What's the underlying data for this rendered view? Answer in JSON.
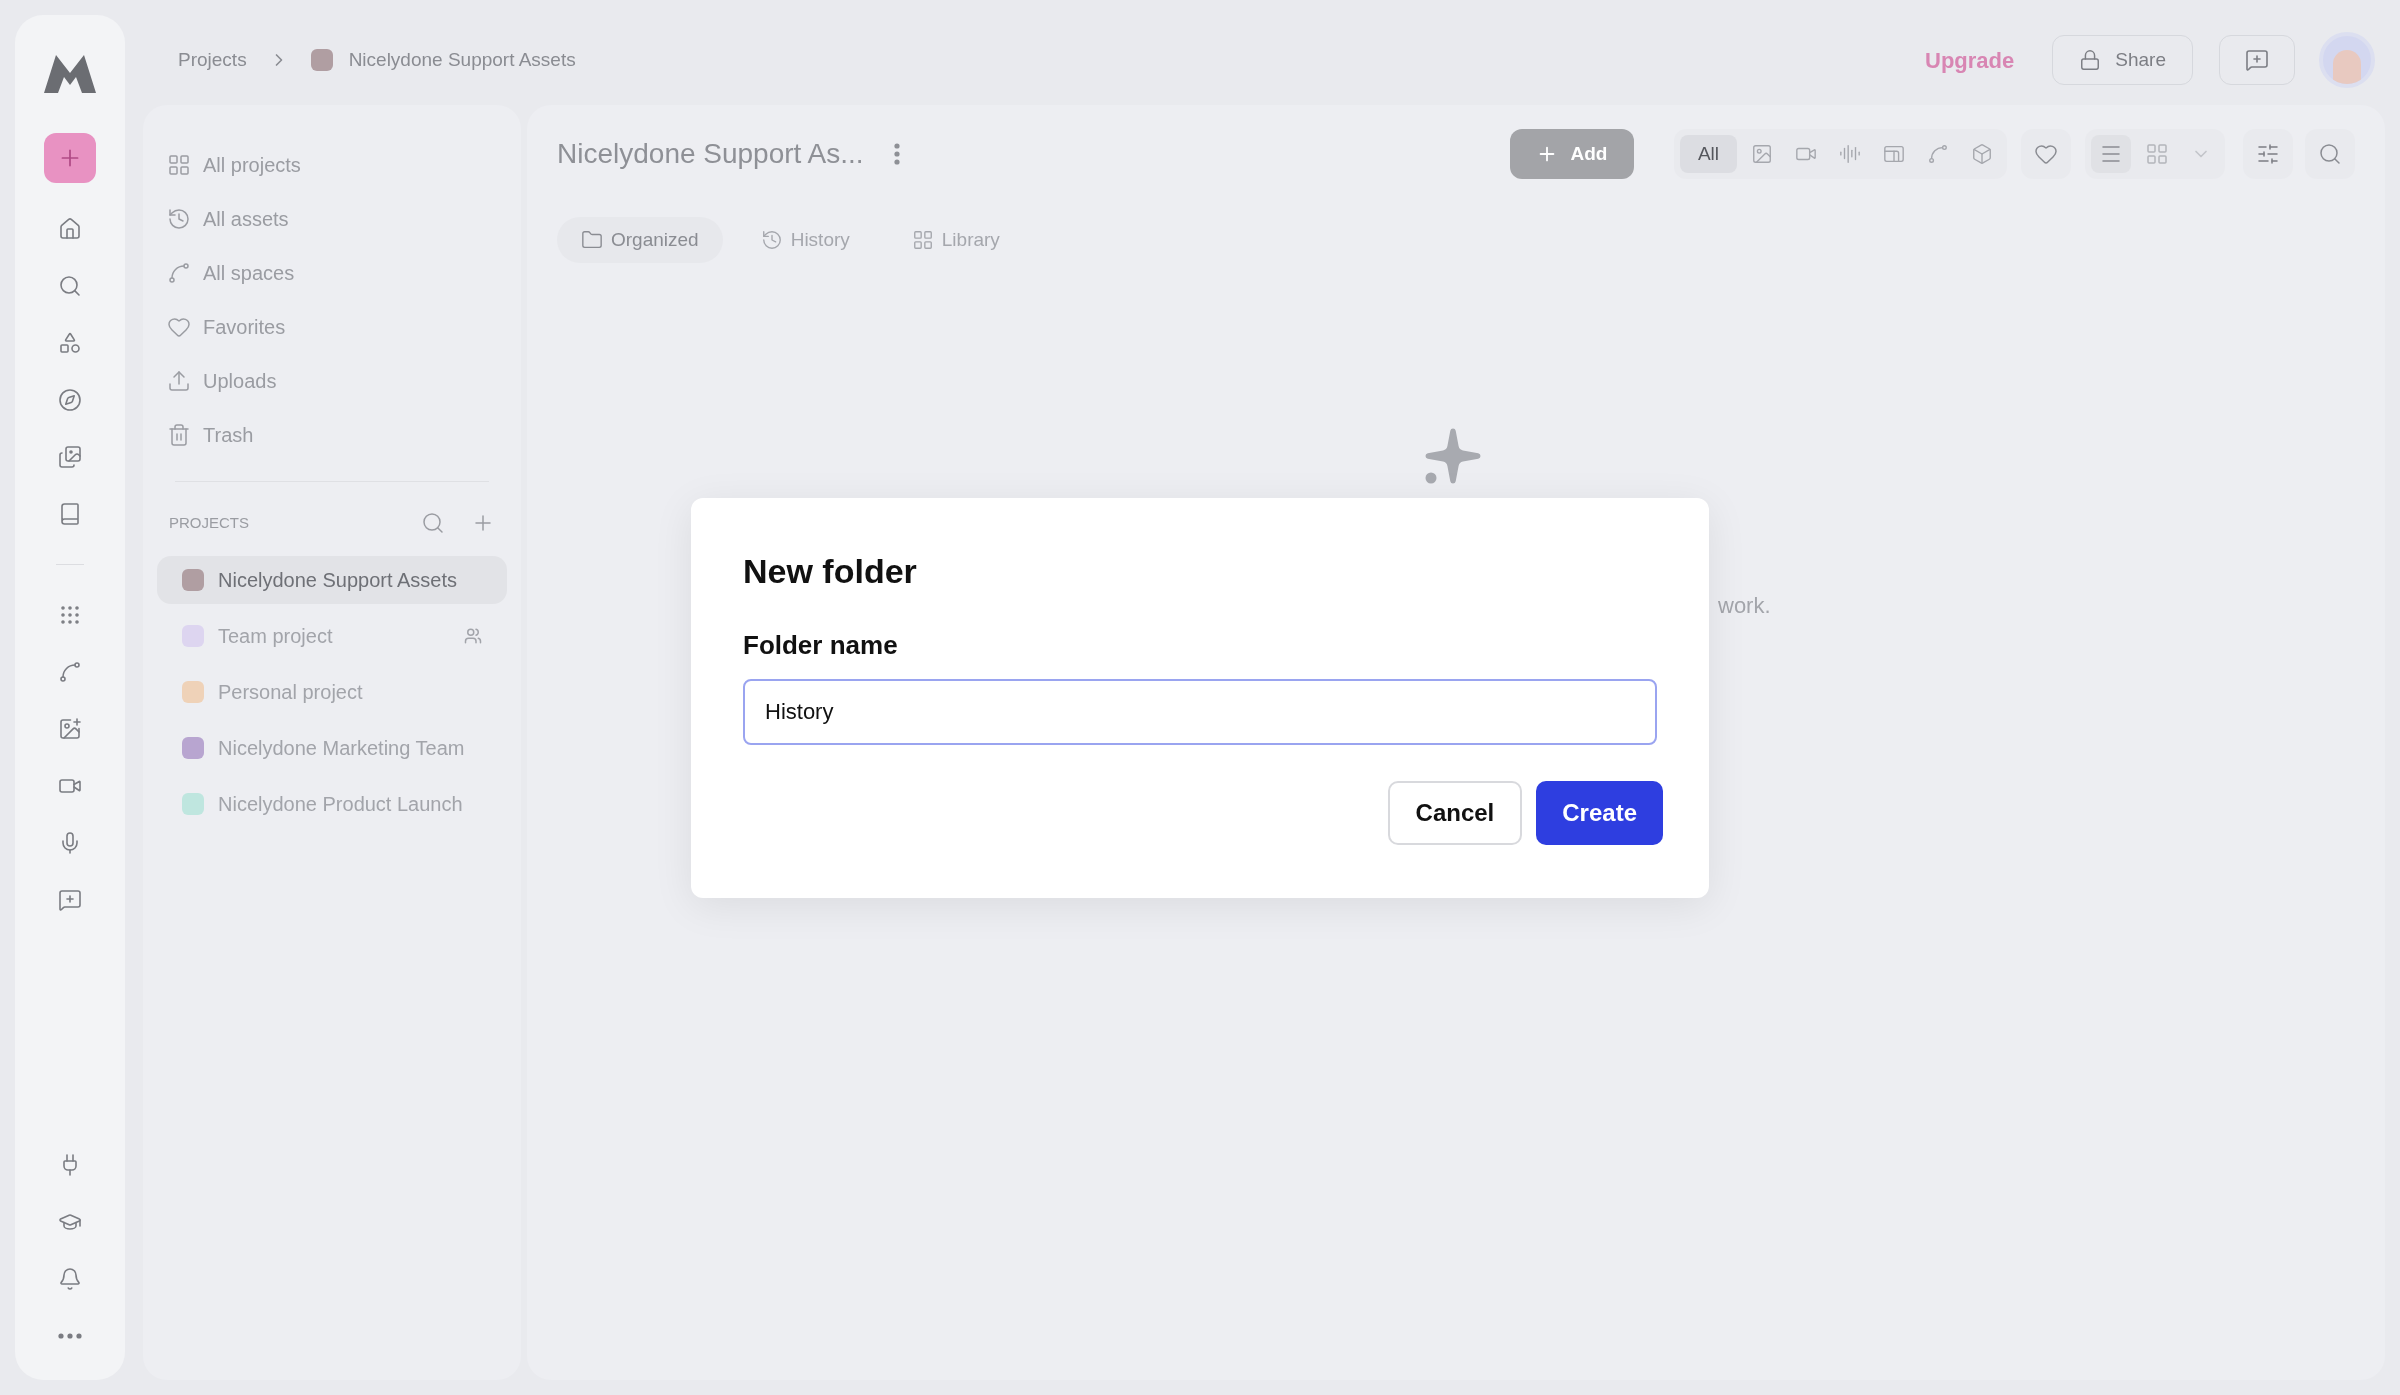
{
  "breadcrumb": {
    "root": "Projects",
    "project": {
      "name": "Nicelydone Support Assets",
      "color": "#b09ea2"
    }
  },
  "header": {
    "upgrade": "Upgrade",
    "share": "Share"
  },
  "nav": [
    {
      "kind": "projects",
      "label": "All projects"
    },
    {
      "kind": "assets",
      "label": "All assets"
    },
    {
      "kind": "spaces",
      "label": "All spaces"
    },
    {
      "kind": "favorites",
      "label": "Favorites"
    },
    {
      "kind": "uploads",
      "label": "Uploads"
    },
    {
      "kind": "trash",
      "label": "Trash"
    }
  ],
  "projects": {
    "heading": "PROJECTS",
    "items": [
      {
        "name": "Nicelydone Support Assets",
        "color": "#b09ea2",
        "selected": true,
        "shared": false
      },
      {
        "name": "Team project",
        "color": "#ddd5f0",
        "selected": false,
        "shared": true
      },
      {
        "name": "Personal project",
        "color": "#efd2b8",
        "selected": false,
        "shared": false
      },
      {
        "name": "Nicelydone Marketing Team",
        "color": "#b8a5d0",
        "selected": false,
        "shared": false
      },
      {
        "name": "Nicelydone Product Launch",
        "color": "#bfe6df",
        "selected": false,
        "shared": false
      }
    ]
  },
  "main": {
    "title": "Nicelydone Support As...",
    "add": "Add",
    "filters": [
      {
        "kind": "all",
        "label": "All",
        "selected": true
      },
      {
        "kind": "image",
        "selected": false
      },
      {
        "kind": "video",
        "selected": false
      },
      {
        "kind": "audio",
        "selected": false
      },
      {
        "kind": "design",
        "selected": false
      },
      {
        "kind": "space",
        "selected": false
      },
      {
        "kind": "cube",
        "selected": false
      }
    ],
    "views": [
      {
        "kind": "list",
        "selected": true
      },
      {
        "kind": "grid",
        "selected": false
      }
    ],
    "tabs": [
      {
        "kind": "organized",
        "label": "Organized",
        "selected": true
      },
      {
        "kind": "history",
        "label": "History",
        "selected": false
      },
      {
        "kind": "library",
        "label": "Library",
        "selected": false
      }
    ],
    "empty_text": "work."
  },
  "dialog": {
    "title": "New folder",
    "label": "Folder name",
    "value": "History",
    "buttons": [
      {
        "kind": "secondary",
        "label": "Cancel"
      },
      {
        "kind": "primary",
        "label": "Create"
      }
    ]
  }
}
